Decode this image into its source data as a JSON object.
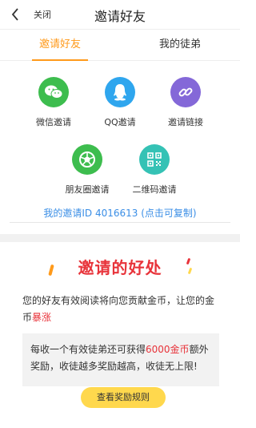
{
  "header": {
    "close_label": "关闭",
    "title": "邀请好友"
  },
  "tabs": [
    {
      "label": "邀请好友",
      "active": true
    },
    {
      "label": "我的徒弟",
      "active": false
    }
  ],
  "share": [
    {
      "label": "微信邀请",
      "icon": "wechat-icon",
      "color": "#3dbd4e"
    },
    {
      "label": "QQ邀请",
      "icon": "qq-icon",
      "color": "#2fa6ee"
    },
    {
      "label": "邀请链接",
      "icon": "link-icon",
      "color": "#8468d8"
    },
    {
      "label": "朋友圈邀请",
      "icon": "moments-icon",
      "color": "#3dbd4e"
    },
    {
      "label": "二维码邀请",
      "icon": "qrcode-icon",
      "color": "#35c2b5"
    }
  ],
  "invite_id_text": "我的邀请ID 4016613 (点击可复制)",
  "benefit": {
    "title": "邀请的好处",
    "desc_prefix": "您的好友有效阅读将向您贡献金币，让您的金币",
    "desc_highlight": "暴涨",
    "box_prefix": "每收一个有效徒弟还可获得",
    "box_highlight": "6000金币",
    "box_suffix": "额外奖励，收徒越多奖励越高，收徒无上限!"
  },
  "rules_button": "查看奖励规则",
  "colors": {
    "accent": "#ff9a1b",
    "link": "#3a8ee6",
    "highlight": "#e8333a",
    "button": "#ffd84d"
  }
}
